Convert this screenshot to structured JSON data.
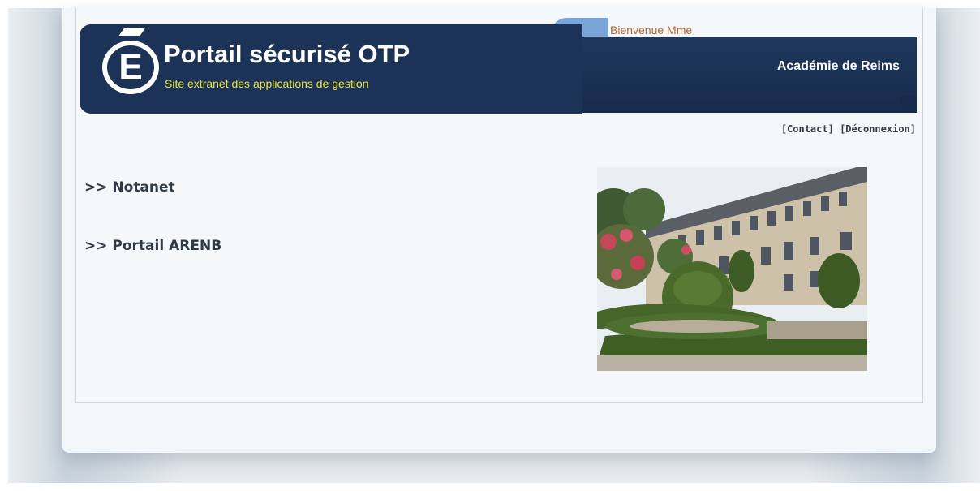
{
  "header": {
    "logo_letter": "E",
    "title": "Portail sécurisé OTP",
    "subtitle": "Site extranet des applications de gestion",
    "welcome": "Bienvenue Mme",
    "academy": "Académie de Reims"
  },
  "toplinks": {
    "contact": "[Contact]",
    "logout": "[Déconnexion]"
  },
  "nav": {
    "items": [
      {
        "label": ">> Notanet"
      },
      {
        "label": ">> Portail ARENB"
      }
    ]
  },
  "colors": {
    "banner": "#1c3357",
    "accent": "#7ba4d8",
    "subtitle": "#e7e13a",
    "welcome": "#b8652a",
    "link": "#2f3a45"
  },
  "icons": {
    "logo": "marianne-e-logo",
    "photo": "garden-building-photo"
  }
}
